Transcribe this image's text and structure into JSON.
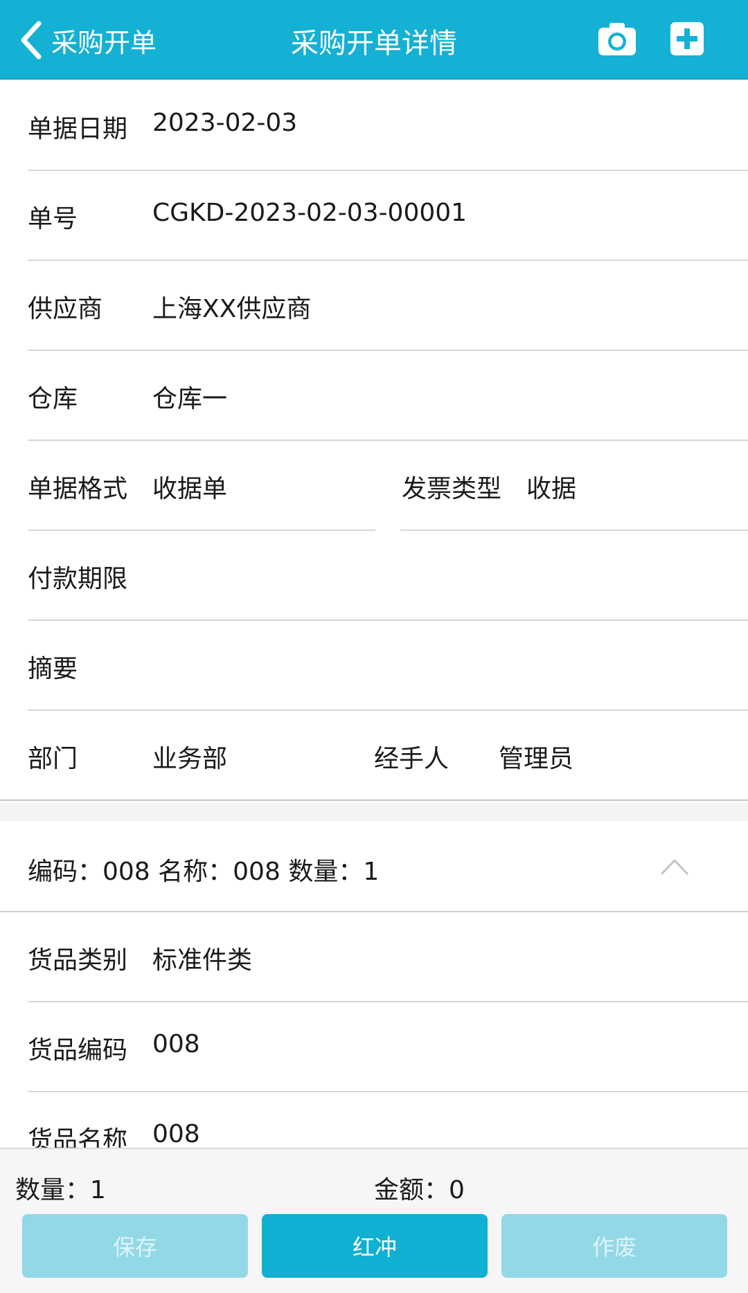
{
  "header": {
    "back_label": "采购开单",
    "title": "采购开单详情",
    "icons": [
      "chevron-left-icon",
      "camera-icon",
      "plus-square-icon"
    ]
  },
  "form": {
    "date_label": "单据日期",
    "date_value": "2023-02-03",
    "number_label": "单号",
    "number_value": "CGKD-2023-02-03-00001",
    "supplier_label": "供应商",
    "supplier_value": "上海XX供应商",
    "warehouse_label": "仓库",
    "warehouse_value": "仓库一",
    "format_label": "单据格式",
    "format_value": "收据单",
    "invoice_type_label": "发票类型",
    "invoice_type_value": "收据",
    "payment_term_label": "付款期限",
    "payment_term_value": "",
    "summary_label": "摘要",
    "summary_value": "",
    "department_label": "部门",
    "department_value": "业务部",
    "handler_label": "经手人",
    "handler_value": "管理员"
  },
  "item": {
    "header_text": "编码：008 名称：008 数量：1",
    "category_label": "货品类别",
    "category_value": "标准件类",
    "code_label": "货品编码",
    "code_value": "008",
    "name_label": "货品名称",
    "name_value": "008"
  },
  "footer": {
    "quantity_text": "数量：1",
    "amount_text": "金额：0",
    "save_label": "保存",
    "reverse_label": "红冲",
    "void_label": "作废"
  },
  "colors": {
    "header": "#14b1d4",
    "primary_button": "#0fb0d2",
    "disabled_button": "#93d8e6"
  }
}
